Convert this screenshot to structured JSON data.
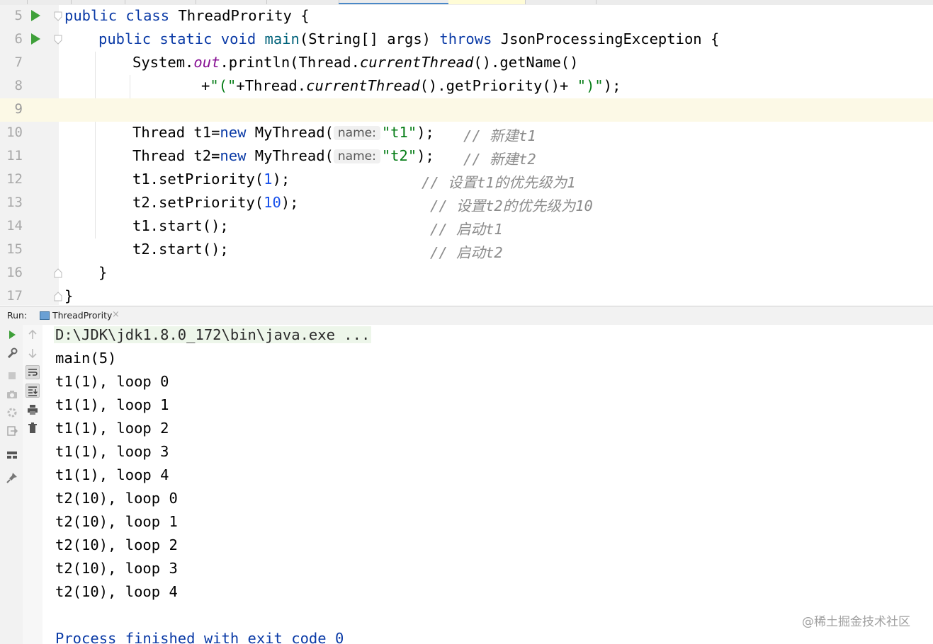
{
  "editor": {
    "lines": [
      {
        "n": "5"
      },
      {
        "n": "6"
      },
      {
        "n": "7"
      },
      {
        "n": "8"
      },
      {
        "n": "9"
      },
      {
        "n": "10"
      },
      {
        "n": "11"
      },
      {
        "n": "12"
      },
      {
        "n": "13"
      },
      {
        "n": "14"
      },
      {
        "n": "15"
      },
      {
        "n": "16"
      },
      {
        "n": "17"
      }
    ],
    "code": {
      "l5_kw": "public class ",
      "l5_rest": "ThreadPrority {",
      "l6_kw1": "public static void ",
      "l6_main": "main",
      "l6_mid": "(String[] args) ",
      "l6_kw2": "throws ",
      "l6_rest": "JsonProcessingException {",
      "l7_a": "System.",
      "l7_out": "out",
      "l7_b": ".println(Thread.",
      "l7_ct": "currentThread",
      "l7_c": "().getName()",
      "l8_a": "+",
      "l8_s1": "\"(\"",
      "l8_b": "+Thread.",
      "l8_ct": "currentThread",
      "l8_c": "().getPriority()+ ",
      "l8_s2": "\")\"",
      "l8_d": ");",
      "l10_a": "Thread t1=",
      "l10_new": "new ",
      "l10_b": "MyThread(",
      "l10_hint": "name:",
      "l10_s": "\"t1\"",
      "l10_c": ");",
      "l10_cmt": "// 新建t1",
      "l11_a": "Thread t2=",
      "l11_new": "new ",
      "l11_b": "MyThread(",
      "l11_hint": "name:",
      "l11_s": "\"t2\"",
      "l11_c": ");",
      "l11_cmt": "// 新建t2",
      "l12_a": "t1.setPriority(",
      "l12_n": "1",
      "l12_b": ");",
      "l12_cmt": "// 设置t1的优先级为1",
      "l13_a": "t2.setPriority(",
      "l13_n": "10",
      "l13_b": ");",
      "l13_cmt": "// 设置t2的优先级为10",
      "l14_a": "t1.start();",
      "l14_cmt": "// 启动t1",
      "l15_a": "t2.start();",
      "l15_cmt": "// 启动t2",
      "l16": "}",
      "l17": "}"
    }
  },
  "run_panel": {
    "label": "Run:",
    "tab_label": "ThreadPrority",
    "tab_close": "×",
    "console": [
      "D:\\JDK\\jdk1.8.0_172\\bin\\java.exe ...",
      "main(5)",
      "t1(1), loop 0",
      "t1(1), loop 1",
      "t1(1), loop 2",
      "t1(1), loop 3",
      "t1(1), loop 4",
      "t2(10), loop 0",
      "t2(10), loop 1",
      "t2(10), loop 2",
      "t2(10), loop 3",
      "t2(10), loop 4",
      "",
      "Process finished with exit code 0"
    ]
  },
  "icons": {
    "run": "run-icon",
    "wrench": "wrench-icon",
    "stop": "stop-icon",
    "camera": "camera-icon",
    "settings": "settings-icon",
    "exit": "exit-icon",
    "layout": "layout-icon",
    "pin": "pin-icon",
    "up": "arrow-up-icon",
    "down": "arrow-down-icon",
    "wrap": "soft-wrap-icon",
    "scroll": "scroll-to-end-icon",
    "print": "print-icon",
    "trash": "trash-icon"
  },
  "watermark": "@稀土掘金技术社区"
}
